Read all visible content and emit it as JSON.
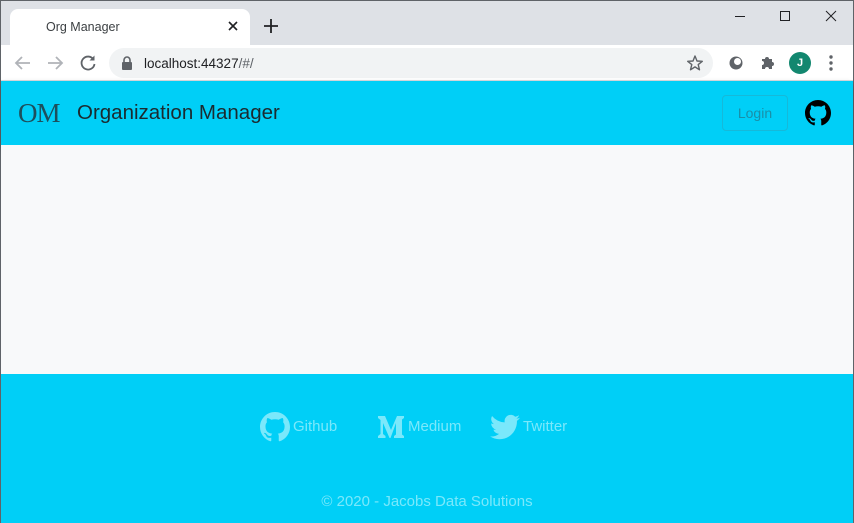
{
  "browser": {
    "tab_title": "Org Manager",
    "url_host": "localhost:44327",
    "url_path": "/#/",
    "profile_initial": "J",
    "icons": {
      "tab_close": "close-icon",
      "new_tab": "plus-icon",
      "back": "arrow-left-icon",
      "forward": "arrow-right-icon",
      "reload": "reload-icon",
      "lock": "lock-icon",
      "bookmark": "star-icon",
      "extension_1": "circle-extension-icon",
      "extension_2": "puzzle-icon",
      "menu": "kebab-menu-icon"
    }
  },
  "navbar": {
    "logo_text": "OM",
    "title": "Organization Manager",
    "login_label": "Login",
    "github_icon": "github-icon",
    "background": "#00cff7"
  },
  "footer": {
    "links": [
      {
        "label": "Github",
        "icon": "github-icon"
      },
      {
        "label": "Medium",
        "icon": "medium-icon"
      },
      {
        "label": "Twitter",
        "icon": "twitter-icon"
      }
    ],
    "copyright": "© 2020 - Jacobs Data Solutions",
    "background": "#00cff7",
    "text_color": "#7ae8fb"
  }
}
